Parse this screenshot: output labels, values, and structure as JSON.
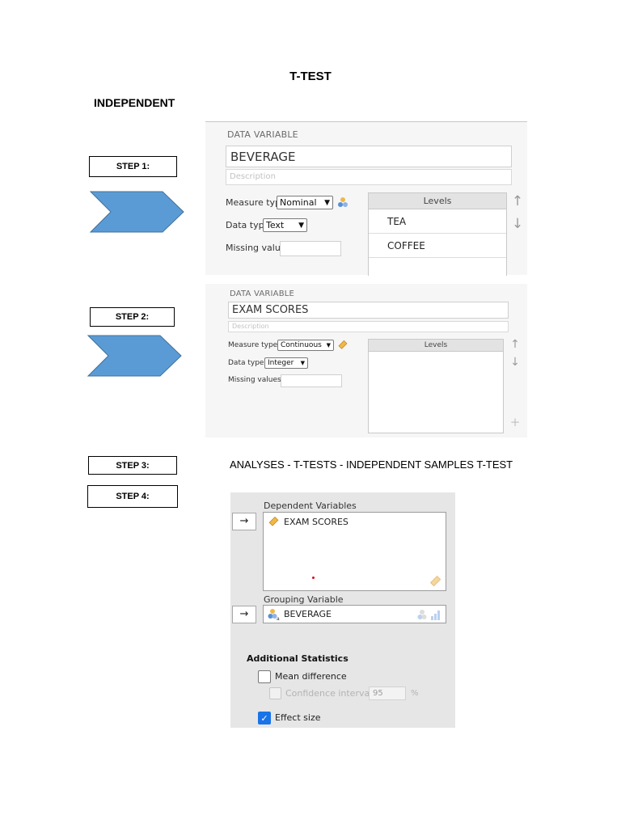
{
  "document": {
    "title": "T-TEST",
    "subtitle": "INDEPENDENT",
    "steps": [
      "STEP 1:",
      "STEP 2:",
      "STEP 3:",
      "STEP 4:"
    ],
    "step3_text": "ANALYSES - T-TESTS - INDEPENDENT SAMPLES T-TEST"
  },
  "panel1": {
    "heading": "DATA VARIABLE",
    "name": "BEVERAGE",
    "description_placeholder": "Description",
    "measure_type_label": "Measure type",
    "measure_type_value": "Nominal",
    "data_type_label": "Data type",
    "data_type_value": "Text",
    "missing_values_label": "Missing values",
    "levels_header": "Levels",
    "levels": [
      "TEA",
      "COFFEE"
    ]
  },
  "panel2": {
    "heading": "DATA VARIABLE",
    "name": "EXAM SCORES",
    "description_placeholder": "Description",
    "measure_type_label": "Measure type",
    "measure_type_value": "Continuous",
    "data_type_label": "Data type",
    "data_type_value": "Integer",
    "missing_values_label": "Missing values",
    "levels_header": "Levels"
  },
  "analysis": {
    "dependent_label": "Dependent Variables",
    "dependent_item": "EXAM SCORES",
    "grouping_label": "Grouping Variable",
    "grouping_item": "BEVERAGE",
    "additional_stats_label": "Additional Statistics",
    "mean_difference_label": "Mean difference",
    "mean_difference_checked": false,
    "confidence_interval_label": "Confidence interval",
    "confidence_interval_value": "95",
    "percent_sign": "%",
    "effect_size_label": "Effect size",
    "effect_size_checked": true
  },
  "colors": {
    "arrow_fill": "#5b9bd5",
    "arrow_stroke": "#41719c",
    "checkbox_accent": "#1a73e8",
    "ruler_icon": "#f0b84a"
  },
  "icons": {
    "move": "arrow-right",
    "up": "arrow-up",
    "down": "arrow-down",
    "add": "plus"
  }
}
